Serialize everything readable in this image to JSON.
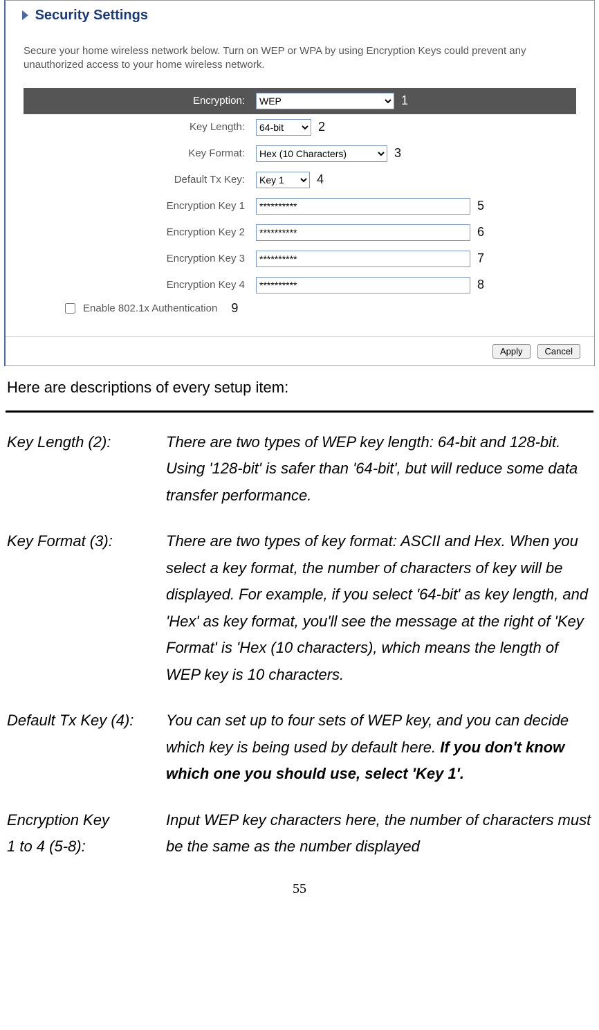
{
  "screenshot": {
    "title": "Security Settings",
    "intro": "Secure your home wireless network below. Turn on WEP or WPA by using Encryption Keys could prevent any unauthorized access to your home wireless network.",
    "fields": {
      "encryption": {
        "label": "Encryption:",
        "value": "WEP",
        "callout": "1"
      },
      "key_length": {
        "label": "Key Length:",
        "value": "64-bit",
        "callout": "2"
      },
      "key_format": {
        "label": "Key Format:",
        "value": "Hex (10 Characters)",
        "callout": "3"
      },
      "default_tx": {
        "label": "Default Tx Key:",
        "value": "Key 1",
        "callout": "4"
      },
      "key1": {
        "label": "Encryption Key 1",
        "value": "**********",
        "callout": "5"
      },
      "key2": {
        "label": "Encryption Key 2",
        "value": "**********",
        "callout": "6"
      },
      "key3": {
        "label": "Encryption Key 3",
        "value": "**********",
        "callout": "7"
      },
      "key4": {
        "label": "Encryption Key 4",
        "value": "**********",
        "callout": "8"
      }
    },
    "auth": {
      "label": "Enable 802.1x Authentication",
      "callout": "9",
      "checked": false
    },
    "buttons": {
      "apply": "Apply",
      "cancel": "Cancel"
    }
  },
  "body": {
    "lead": "Here are descriptions of every setup item:",
    "items": [
      {
        "term": "Key Length (2):",
        "text": "There are two types of WEP key length: 64-bit and 128-bit. Using '128-bit' is safer than '64-bit', but will reduce some data transfer performance."
      },
      {
        "term": "Key Format (3):",
        "text": "There are two types of key format: ASCII and Hex. When you select a key format, the number of characters of key will be displayed. For example, if you select '64-bit' as key length, and 'Hex' as key format, you'll see the message at the right of 'Key Format' is 'Hex (10 characters), which means the length of WEP key is 10 characters."
      },
      {
        "term": "Default Tx Key (4):",
        "text_pre": "You can set up to four sets of WEP key, and you can decide which key is being used by default here. ",
        "text_bold": "If you don't know which one you should use, select 'Key 1'."
      },
      {
        "term_line1": "Encryption Key",
        "term_line2": "1 to 4 (5-8):",
        "text": "Input WEP key characters here, the number of characters must be the same as the number displayed"
      }
    ]
  },
  "page_number": "55"
}
